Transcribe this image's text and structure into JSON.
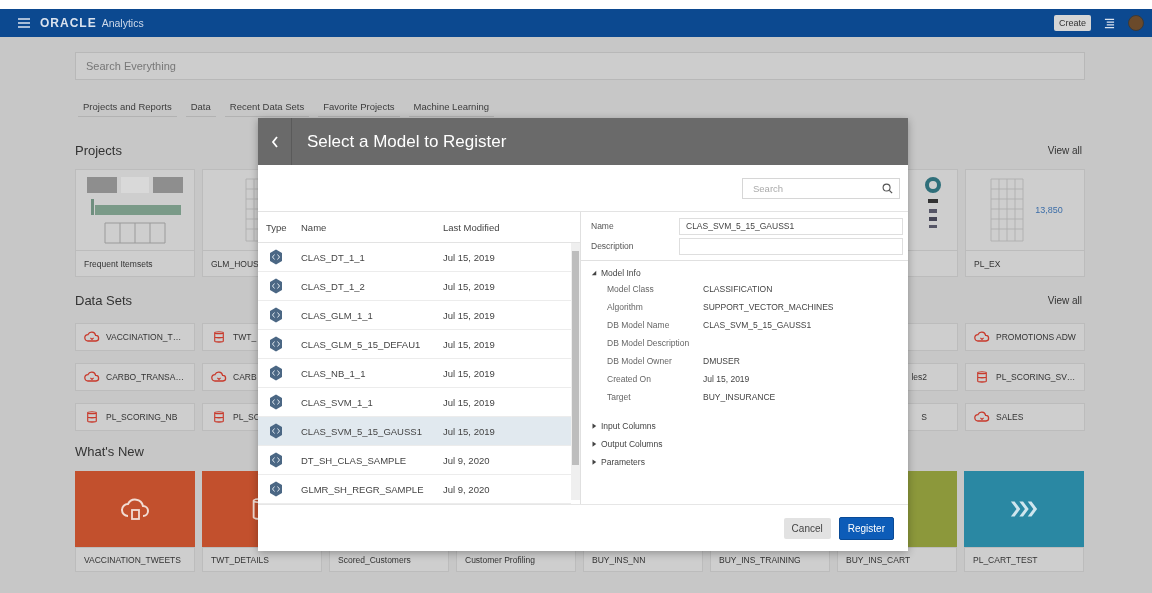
{
  "header": {
    "brand": "ORACLE",
    "product": "Analytics",
    "create_button": "Create"
  },
  "search": {
    "placeholder": "Search Everything"
  },
  "tabs": [
    {
      "label": "Projects and Reports",
      "selected": false
    },
    {
      "label": "Data",
      "selected": false
    },
    {
      "label": "Recent Data Sets",
      "selected": false
    },
    {
      "label": "Favorite Projects",
      "selected": false
    },
    {
      "label": "Machine Learning",
      "selected": false
    }
  ],
  "projects": {
    "title": "Projects",
    "view_all": "View all",
    "left": [
      {
        "name": "Frequent Itemsets",
        "kind": "bars"
      },
      {
        "name": "GLM_HOUS",
        "kind": "table"
      }
    ],
    "right": [
      {
        "kind": "donut"
      },
      {
        "name": "PL_EX",
        "kind": "table",
        "figure": "13,850"
      }
    ]
  },
  "data_sets": {
    "title": "Data Sets",
    "view_all": "View all",
    "rows": [
      {
        "left": [
          {
            "name": "VACCINATION_T…",
            "kind": "cloud"
          },
          {
            "name": "TWT_",
            "kind": "database"
          }
        ],
        "right": [
          {
            "kind": "clipped"
          },
          {
            "name": "PROMOTIONS ADW",
            "kind": "cloud"
          }
        ]
      },
      {
        "left": [
          {
            "name": "CARBO_TRANSA…",
            "kind": "cloud"
          },
          {
            "name": "CARB",
            "kind": "cloud"
          }
        ],
        "right": [
          {
            "name": "les2",
            "kind": "clipped"
          },
          {
            "name": "PL_SCORING_SV…",
            "kind": "database"
          }
        ]
      },
      {
        "left": [
          {
            "name": "PL_SCORING_NB",
            "kind": "database"
          },
          {
            "name": "PL_SC",
            "kind": "database"
          }
        ],
        "right": [
          {
            "name": "S",
            "kind": "clipped"
          },
          {
            "name": "SALES",
            "kind": "cloud"
          }
        ]
      }
    ]
  },
  "whats_new": {
    "title": "What's New",
    "tiles": [
      {
        "name": "VACCINATION_TWEETS",
        "color": "#c2502d",
        "kind": "cloud"
      },
      {
        "name": "TWT_DETAILS",
        "color": "#c2502d",
        "kind": "database"
      },
      {
        "name": "Scored_Customers"
      },
      {
        "name": "Customer Profiling"
      },
      {
        "name": "BUY_INS_NN"
      },
      {
        "name": "BUY_INS_TRAINING"
      },
      {
        "name": "BUY_INS_CART",
        "color": "#8c983b"
      },
      {
        "name": "PL_CART_TEST",
        "color": "#2a88a3",
        "kind": "arrows"
      }
    ]
  },
  "modal": {
    "title": "Select a Model to Register",
    "search_placeholder": "Search",
    "columns": [
      "Type",
      "Name",
      "Last Modified"
    ],
    "models": [
      {
        "name": "CLAS_DT_1_1",
        "modified": "Jul 15, 2019",
        "selected": false
      },
      {
        "name": "CLAS_DT_1_2",
        "modified": "Jul 15, 2019",
        "selected": false
      },
      {
        "name": "CLAS_GLM_1_1",
        "modified": "Jul 15, 2019",
        "selected": false
      },
      {
        "name": "CLAS_GLM_5_15_DEFAU1",
        "modified": "Jul 15, 2019",
        "selected": false
      },
      {
        "name": "CLAS_NB_1_1",
        "modified": "Jul 15, 2019",
        "selected": false
      },
      {
        "name": "CLAS_SVM_1_1",
        "modified": "Jul 15, 2019",
        "selected": false
      },
      {
        "name": "CLAS_SVM_5_15_GAUSS1",
        "modified": "Jul 15, 2019",
        "selected": true
      },
      {
        "name": "DT_SH_CLAS_SAMPLE",
        "modified": "Jul 9, 2020",
        "selected": false
      },
      {
        "name": "GLMR_SH_REGR_SAMPLE",
        "modified": "Jul 9, 2020",
        "selected": false
      }
    ],
    "fields": [
      {
        "label": "Name",
        "value": "CLAS_SVM_5_15_GAUSS1"
      },
      {
        "label": "Description"
      }
    ],
    "sections": [
      {
        "title": "Model Info",
        "expanded": true,
        "rows": [
          {
            "label": "Model Class",
            "value": "CLASSIFICATION"
          },
          {
            "label": "Algorithm",
            "value": "SUPPORT_VECTOR_MACHINES"
          },
          {
            "label": "DB Model Name",
            "value": "CLAS_SVM_5_15_GAUSS1"
          },
          {
            "label": "DB Model Description"
          },
          {
            "label": "DB Model Owner",
            "value": "DMUSER"
          },
          {
            "label": "Created On",
            "value": "Jul 15, 2019"
          },
          {
            "label": "Target",
            "value": "BUY_INSURANCE"
          }
        ]
      },
      {
        "title": "Input Columns",
        "expanded": false
      },
      {
        "title": "Output Columns",
        "expanded": false
      },
      {
        "title": "Parameters",
        "expanded": false
      }
    ],
    "buttons": [
      {
        "label": "Cancel",
        "kind": "secondary"
      },
      {
        "label": "Register",
        "kind": "primary"
      }
    ]
  }
}
